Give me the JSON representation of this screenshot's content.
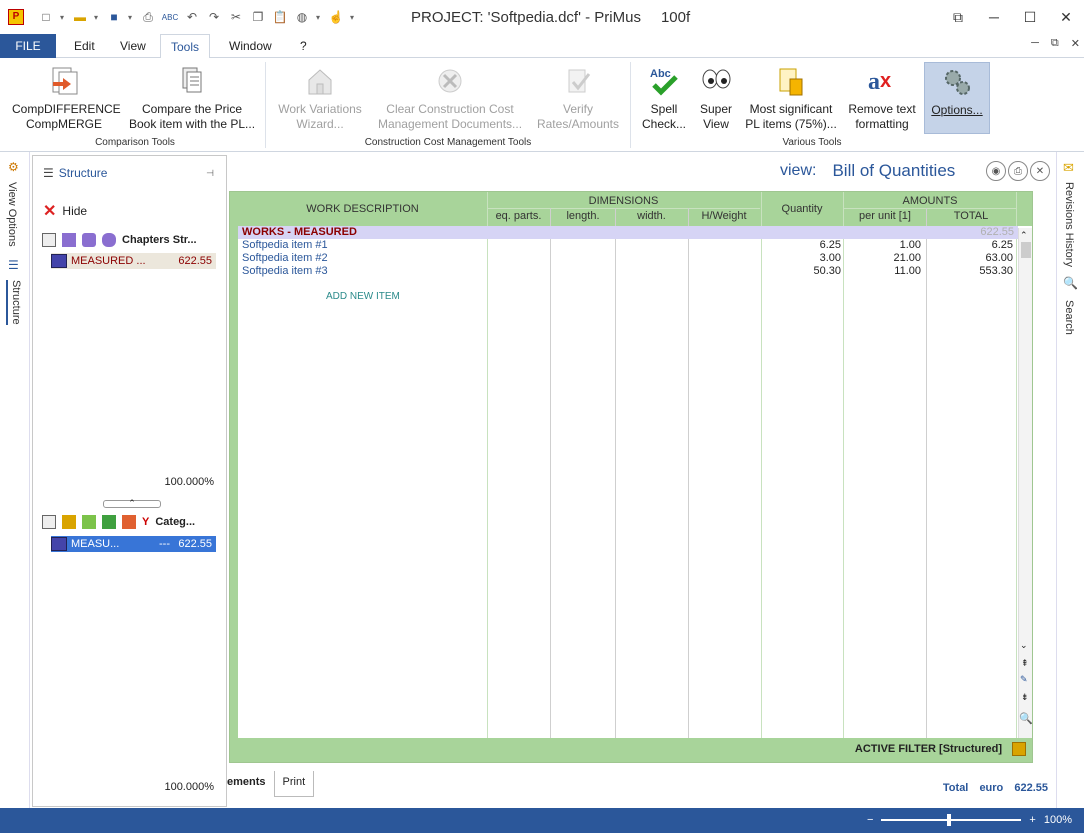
{
  "window": {
    "title": "PROJECT: 'Softpedia.dcf' - PriMus",
    "version": "100f",
    "app_icon_letter": "P"
  },
  "menu": {
    "file": "FILE",
    "tabs": [
      "Edit",
      "View",
      "Tools",
      "Window",
      "?"
    ],
    "active_tab": "Tools"
  },
  "ribbon": {
    "comparison": {
      "label": "Comparison Tools",
      "btn1": [
        "CompDIFFERENCE",
        "CompMERGE"
      ],
      "btn2": [
        "Compare the Price",
        "Book item with the PL..."
      ]
    },
    "ccm": {
      "label": "Construction Cost Management Tools",
      "btn1": [
        "Work Variations",
        "Wizard..."
      ],
      "btn2": [
        "Clear Construction Cost",
        "Management Documents..."
      ],
      "btn3": [
        "Verify",
        "Rates/Amounts"
      ]
    },
    "various": {
      "label": "Various Tools",
      "btn1": [
        "Spell",
        "Check..."
      ],
      "btn2": [
        "Super",
        "View"
      ],
      "btn3": [
        "Most significant",
        "PL items (75%)..."
      ],
      "btn4": [
        "Remove text",
        "formatting"
      ],
      "btn5": [
        "Options..."
      ]
    }
  },
  "left_strip": {
    "view_options": "View Options",
    "structure": "Structure"
  },
  "structure_panel": {
    "title": "Structure",
    "hide": "Hide",
    "chapters_label": "Chapters Str...",
    "chapter_item": "MEASURED ...",
    "chapter_item_value": "622.55",
    "pct_top": "100.000%",
    "categ_label": "Categ...",
    "categ_item": "MEASU...",
    "categ_item_dash": "---",
    "categ_item_value": "622.55",
    "pct_bottom": "100.000%"
  },
  "view": {
    "prefix": "view:",
    "name": "Bill of Quantities"
  },
  "grid": {
    "headers": {
      "work_description": "WORK DESCRIPTION",
      "dimensions": "DIMENSIONS",
      "eq_parts": "eq. parts.",
      "length": "length.",
      "width": "width.",
      "hweight": "H/Weight",
      "quantity": "Quantity",
      "amounts": "AMOUNTS",
      "per_unit": "per unit [1]",
      "total": "TOTAL"
    },
    "chapter": {
      "label": "WORKS - MEASURED",
      "total": "622.55"
    },
    "rows": [
      {
        "desc": "Softpedia item #1",
        "quantity": "6.25",
        "per_unit": "1.00",
        "total": "6.25"
      },
      {
        "desc": "Softpedia item #2",
        "quantity": "3.00",
        "per_unit": "21.00",
        "total": "63.00"
      },
      {
        "desc": "Softpedia item #3",
        "quantity": "50.30",
        "per_unit": "11.00",
        "total": "553.30"
      }
    ],
    "add_item": "ADD NEW ITEM",
    "filter": "ACTIVE FILTER [Structured]"
  },
  "bottom": {
    "tab_elements": "ements",
    "tab_print": "Print",
    "total_label": "Total",
    "currency": "euro",
    "total_value": "622.55"
  },
  "right_strip": {
    "revisions": "Revisions History",
    "search": "Search"
  },
  "status": {
    "zoom": "100%"
  },
  "colors": {
    "accent": "#2b579a",
    "grid_header": "#a8d49a",
    "chapter_row": "#d6d4f5",
    "chapter_text": "#8b0000"
  }
}
